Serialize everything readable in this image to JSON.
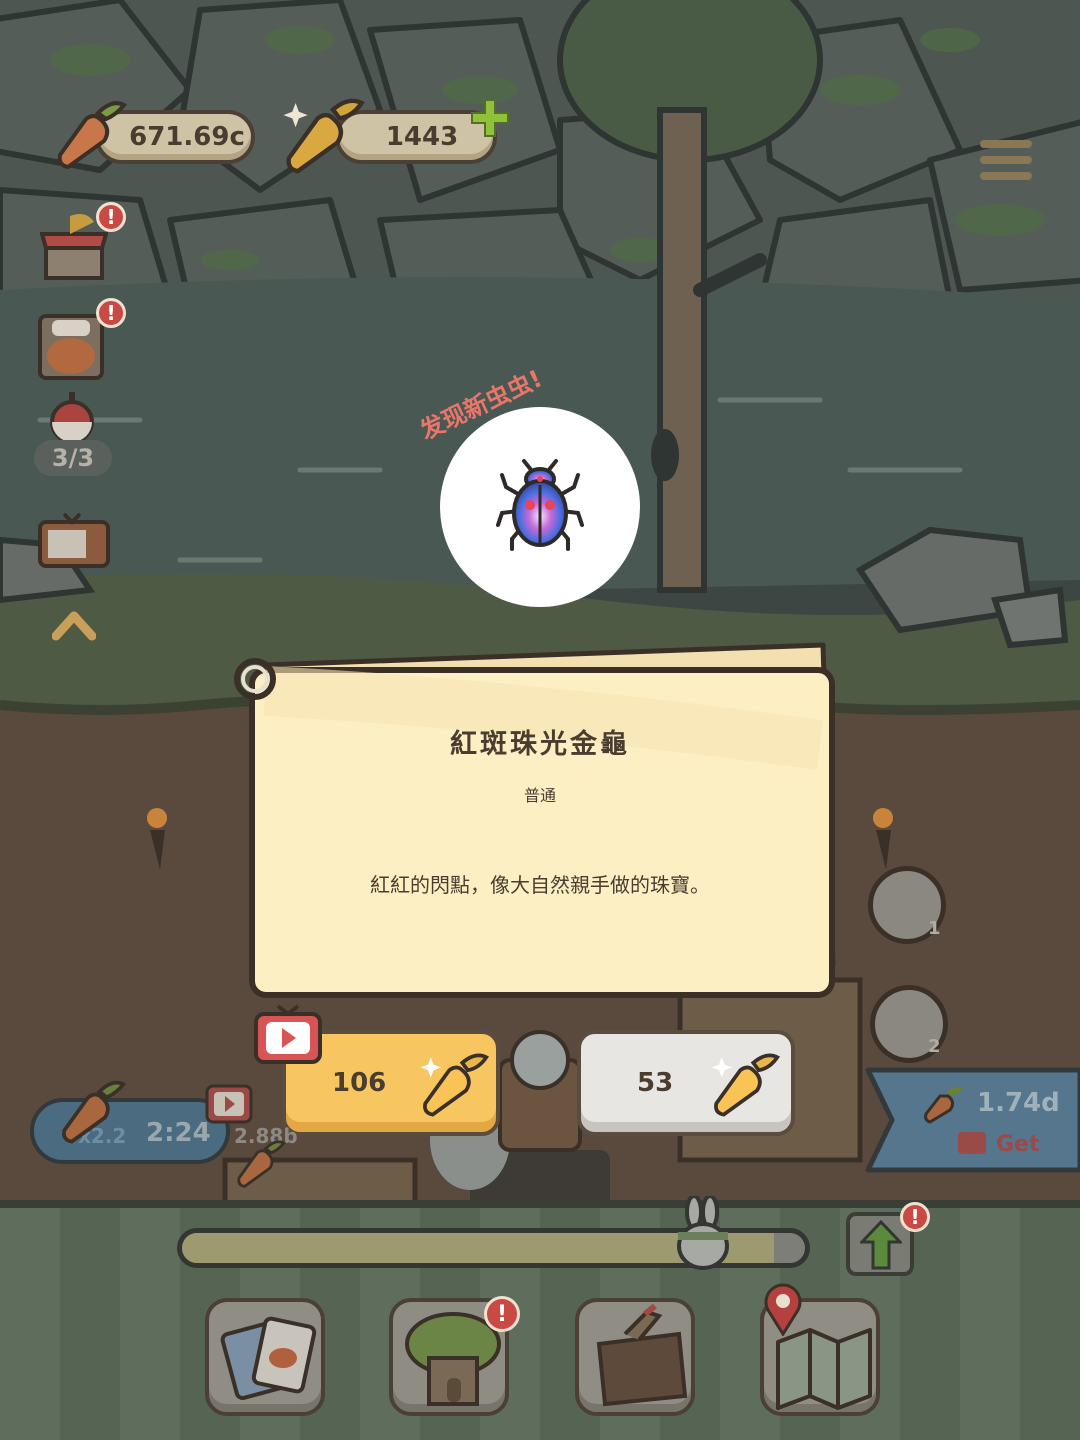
{
  "hud": {
    "carrots": "671.69c",
    "golden_carrots": "1443",
    "bait_count": "3/3",
    "boost_multiplier": "x2.2",
    "boost_timer": "2:24",
    "boost_income": "2.88b",
    "offer_amount": "1.74d",
    "offer_get_label": "Get",
    "plate_count_1": "1",
    "plate_count_2": "2",
    "progress_fraction": 0.95
  },
  "popup": {
    "discovery_label": "发现新虫虫!",
    "title": "紅斑珠光金龜",
    "rarity": "普通",
    "description": "紅紅的閃點，像大自然親手做的珠寶。"
  },
  "actions": {
    "video_reward_amount": "106",
    "buy_amount": "53"
  },
  "colors": {
    "dialog_bg": "#fdefc4",
    "accent_gold": "#f7c660",
    "alert_red": "#c94a45",
    "offer_blue": "#6a8ea6"
  },
  "icons": [
    "carrot-icon",
    "golden-carrot-icon",
    "plus-icon",
    "menu-icon",
    "shop-icon",
    "chef-dog-icon",
    "fishing-bobber-icon",
    "tv-icon",
    "chevron-up-icon",
    "beetle-icon",
    "video-icon",
    "upgrade-arrow-icon",
    "album-cards-icon",
    "tree-house-icon",
    "backpack-icon",
    "map-icon",
    "bunny-icon"
  ]
}
